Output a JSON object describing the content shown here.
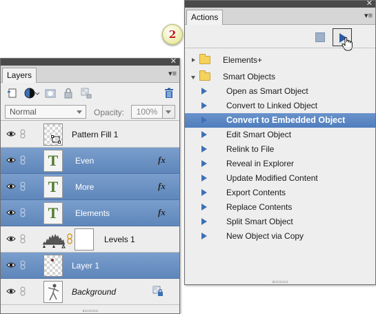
{
  "layers_panel": {
    "close_glyph": "✕",
    "tab_label": "Layers",
    "blend_mode": "Normal",
    "opacity_label": "Opacity:",
    "opacity_value": "100%",
    "layers": [
      {
        "name": "Pattern Fill 1",
        "selected": false,
        "type": "pattern",
        "fx": false
      },
      {
        "name": "Even",
        "selected": true,
        "type": "text",
        "fx": true
      },
      {
        "name": "More",
        "selected": true,
        "type": "text",
        "fx": true
      },
      {
        "name": "Elements",
        "selected": true,
        "type": "text",
        "fx": true
      },
      {
        "name": "Levels 1",
        "selected": false,
        "type": "adjustment",
        "fx": false
      },
      {
        "name": "Layer 1",
        "selected": true,
        "type": "pixel",
        "fx": false
      },
      {
        "name": "Background",
        "selected": false,
        "type": "background",
        "fx": false
      }
    ],
    "fx_label": "fx",
    "text_thumb_glyph": "T"
  },
  "actions_panel": {
    "close_glyph": "✕",
    "tab_label": "Actions",
    "badge_number": "2",
    "items": [
      {
        "label": "Elements+",
        "kind": "group",
        "expanded": false
      },
      {
        "label": "Smart Objects",
        "kind": "group",
        "expanded": true
      },
      {
        "label": "Open as Smart Object",
        "kind": "action"
      },
      {
        "label": "Convert to Linked Object",
        "kind": "action"
      },
      {
        "label": "Convert to Embedded Object",
        "kind": "action",
        "selected": true
      },
      {
        "label": "Edit Smart Object",
        "kind": "action"
      },
      {
        "label": "Relink to File",
        "kind": "action"
      },
      {
        "label": "Reveal in Explorer",
        "kind": "action"
      },
      {
        "label": "Update Modified Content",
        "kind": "action"
      },
      {
        "label": "Export Contents",
        "kind": "action"
      },
      {
        "label": "Replace Contents",
        "kind": "action"
      },
      {
        "label": "Split Smart Object",
        "kind": "action"
      },
      {
        "label": "New Object via Copy",
        "kind": "action"
      }
    ]
  },
  "colors": {
    "selection": "#5f86ba",
    "panel_bg": "#eeeeee",
    "badge_number": "#c0161a"
  }
}
